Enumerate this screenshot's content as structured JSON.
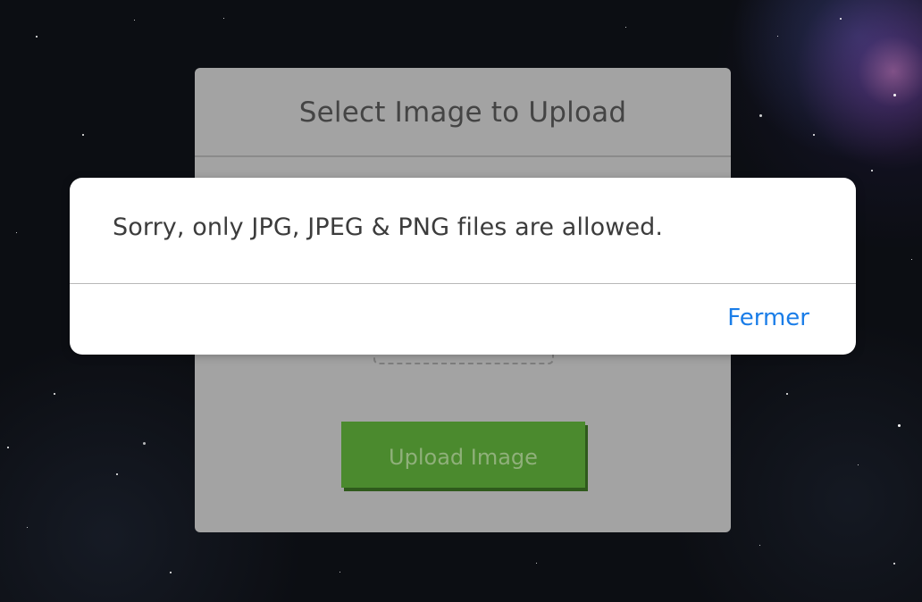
{
  "upload_card": {
    "title": "Select Image to Upload",
    "upload_button_label": "Upload Image"
  },
  "alert": {
    "message": "Sorry, only JPG, JPEG & PNG files are allowed.",
    "close_label": "Fermer"
  },
  "colors": {
    "link_blue": "#1a7de8",
    "upload_green": "#4b8a2e",
    "overlay_gray": "#a3a3a3"
  }
}
